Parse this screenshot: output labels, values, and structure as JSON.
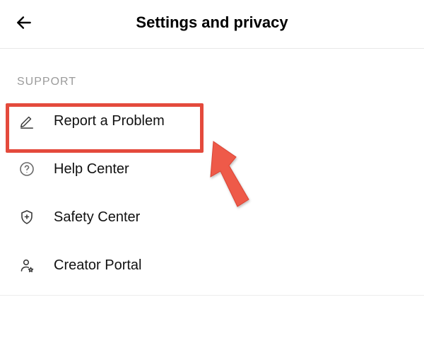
{
  "header": {
    "title": "Settings and privacy"
  },
  "section": {
    "label": "SUPPORT"
  },
  "items": [
    {
      "label": "Report a Problem"
    },
    {
      "label": "Help Center"
    },
    {
      "label": "Safety Center"
    },
    {
      "label": "Creator Portal"
    }
  ],
  "annotation": {
    "highlight_color": "#e44a3c"
  }
}
